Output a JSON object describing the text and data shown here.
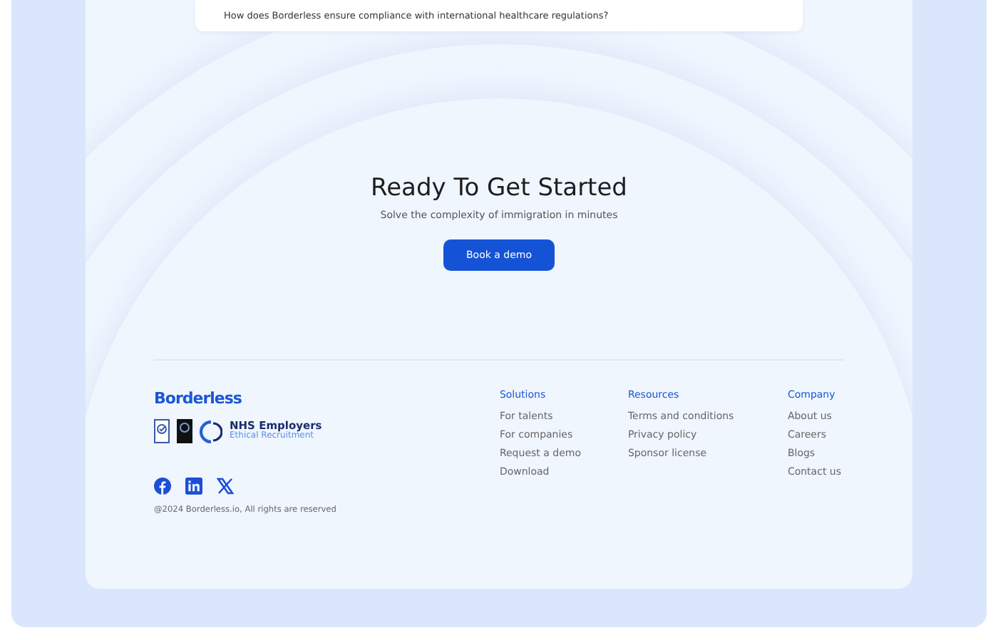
{
  "faq_item": {
    "question": "How does Borderless ensure compliance with international healthcare regulations?"
  },
  "cta": {
    "title": "Ready To Get Started",
    "subtitle": "Solve the complexity of immigration in minutes",
    "button": "Book a demo"
  },
  "footer": {
    "brand": "Borderless",
    "badge": {
      "title": "NHS Employers",
      "subtitle": "Ethical Recruitment"
    },
    "columns": [
      {
        "heading": "Solutions",
        "links": [
          "For talents",
          "For companies",
          "Request a demo",
          "Download"
        ]
      },
      {
        "heading": "Resources",
        "links": [
          "Terms and conditions",
          "Privacy policy",
          "Sponsor license"
        ]
      },
      {
        "heading": "Company",
        "links": [
          "About us",
          "Careers",
          "Blogs",
          "Contact us"
        ]
      }
    ],
    "socials": [
      {
        "kind": "facebook"
      },
      {
        "kind": "linkedin"
      },
      {
        "kind": "x"
      }
    ],
    "copyright": "@2024 Borderless.io, All rights are reserved"
  }
}
